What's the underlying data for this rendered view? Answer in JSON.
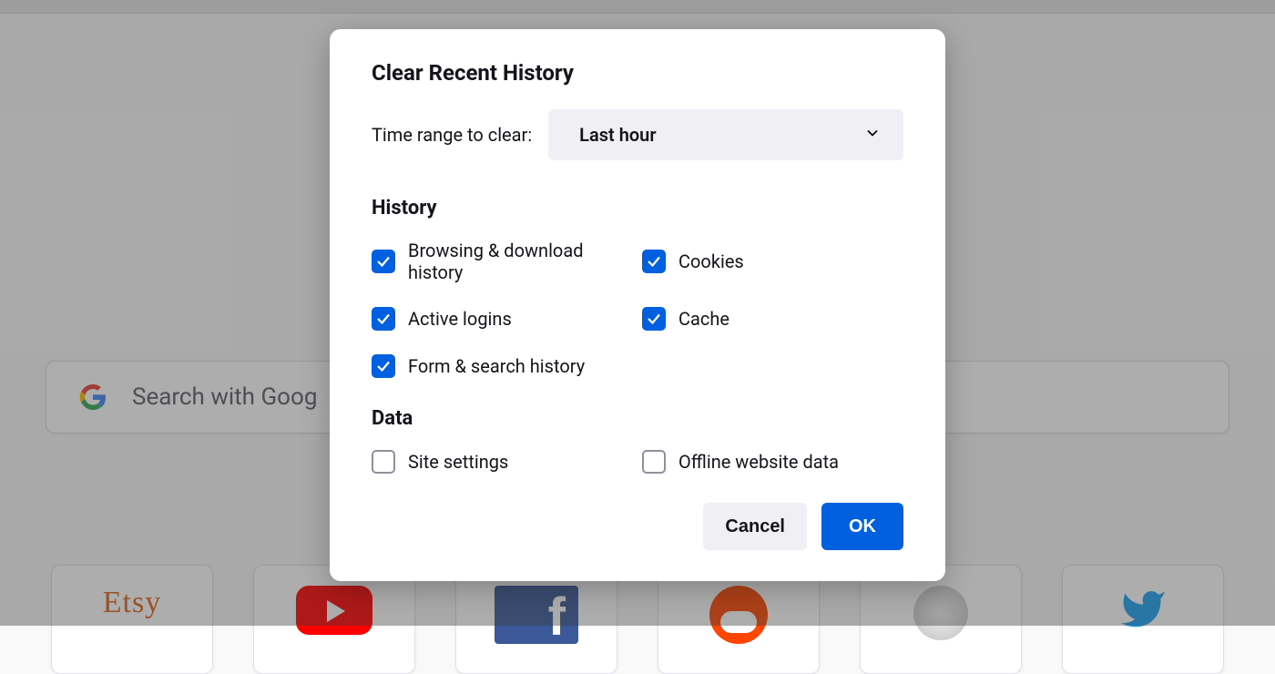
{
  "background": {
    "search_placeholder": "Search with Goog",
    "tiles": [
      "Etsy",
      "YouTube",
      "Facebook",
      "Reddit",
      "Wikipedia",
      "Twitter"
    ]
  },
  "dialog": {
    "title": "Clear Recent History",
    "range_label": "Time range to clear:",
    "range_value": "Last hour",
    "sections": {
      "history": {
        "heading": "History",
        "items": [
          {
            "label": "Browsing & download history",
            "checked": true
          },
          {
            "label": "Cookies",
            "checked": true
          },
          {
            "label": "Active logins",
            "checked": true
          },
          {
            "label": "Cache",
            "checked": true
          },
          {
            "label": "Form & search history",
            "checked": true
          }
        ]
      },
      "data": {
        "heading": "Data",
        "items": [
          {
            "label": "Site settings",
            "checked": false
          },
          {
            "label": "Offline website data",
            "checked": false
          }
        ]
      }
    },
    "buttons": {
      "cancel": "Cancel",
      "ok": "OK"
    },
    "colors": {
      "accent": "#0060df"
    }
  }
}
